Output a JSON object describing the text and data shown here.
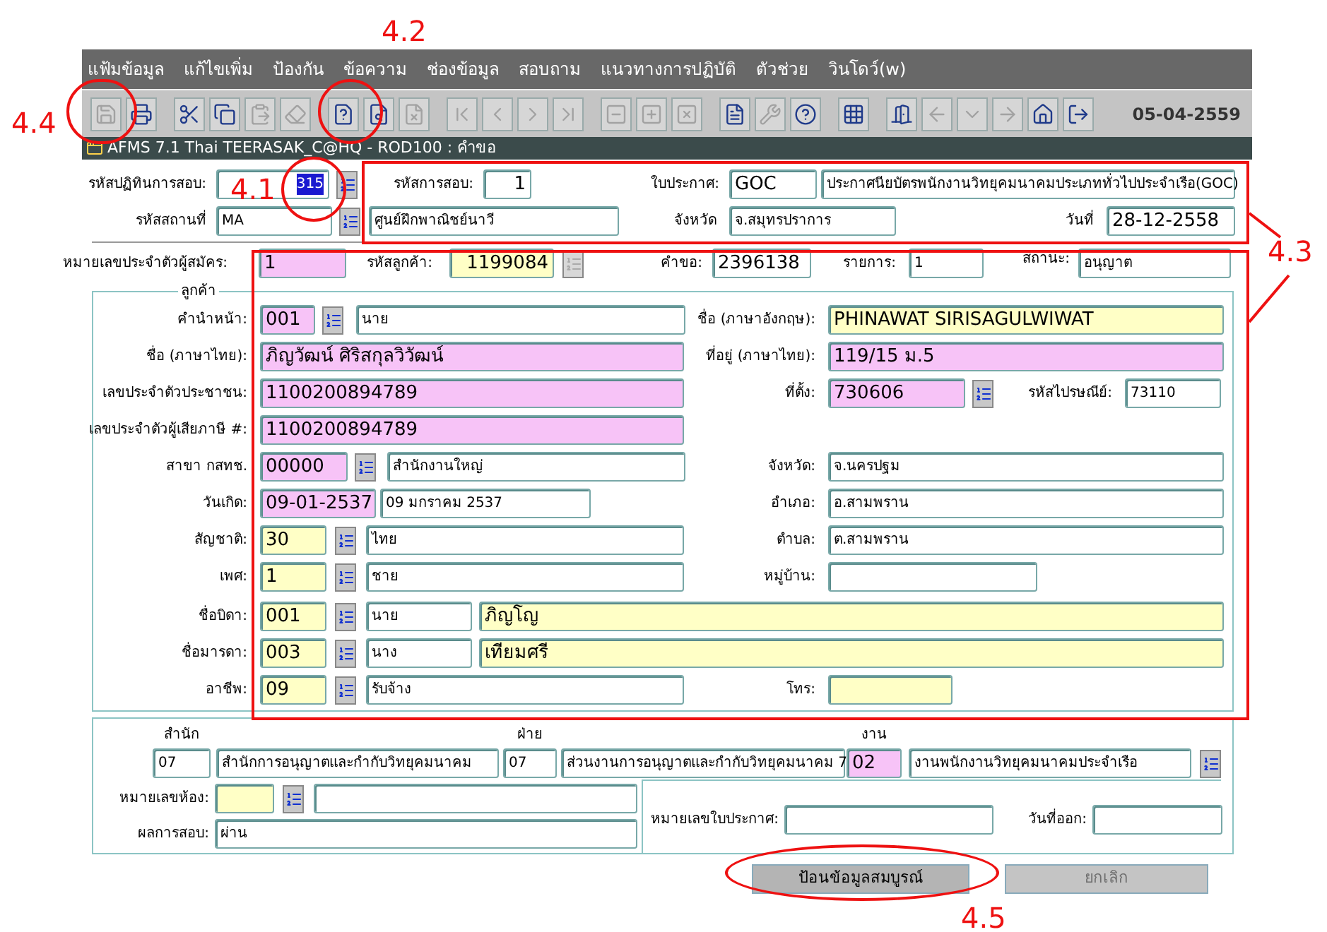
{
  "menu": [
    "แฟ้มข้อมูล",
    "แก้ไขเพิ่ม",
    "ป้องกัน",
    "ข้อความ",
    "ช่องข้อมูล",
    "สอบถาม",
    "แนวทางการปฏิบัติ",
    "ตัวช่วย",
    "วินโดว์(w)"
  ],
  "toolbar": [
    {
      "buttons": [
        {
          "kind": "save",
          "disabled": true
        },
        {
          "kind": "print",
          "disabled": false
        }
      ]
    },
    {
      "buttons": [
        {
          "kind": "cut",
          "disabled": false
        },
        {
          "kind": "copy",
          "disabled": false
        },
        {
          "kind": "paste",
          "disabled": true
        },
        {
          "kind": "clear",
          "disabled": true
        }
      ]
    },
    {
      "buttons": [
        {
          "kind": "enter_query",
          "disabled": false
        },
        {
          "kind": "execute_query",
          "disabled": false
        },
        {
          "kind": "cancel_query",
          "disabled": true
        }
      ]
    },
    {
      "buttons": [
        {
          "kind": "first",
          "disabled": true
        },
        {
          "kind": "prev",
          "disabled": true
        },
        {
          "kind": "next",
          "disabled": true
        },
        {
          "kind": "last",
          "disabled": true
        }
      ]
    },
    {
      "buttons": [
        {
          "kind": "delete_record",
          "disabled": true
        },
        {
          "kind": "insert_record",
          "disabled": true
        },
        {
          "kind": "clear_record",
          "disabled": true
        }
      ]
    },
    {
      "buttons": [
        {
          "kind": "report",
          "disabled": false
        },
        {
          "kind": "tool",
          "disabled": true
        },
        {
          "kind": "help",
          "disabled": false
        }
      ]
    },
    {
      "buttons": [
        {
          "kind": "calendar",
          "disabled": false
        }
      ]
    },
    {
      "buttons": [
        {
          "kind": "door",
          "disabled": false
        },
        {
          "kind": "back",
          "disabled": true
        },
        {
          "kind": "dropdown",
          "disabled": true
        },
        {
          "kind": "forward",
          "disabled": true
        },
        {
          "kind": "home",
          "disabled": false
        },
        {
          "kind": "exit",
          "disabled": false
        }
      ]
    }
  ],
  "toolbar_date": "05-04-2559",
  "window": {
    "title": "AFMS 7.1 Thai TEERASAK_C@HQ - ROD100 : คำขอ"
  },
  "header": {
    "exam_calendar": {
      "label": "รหัสปฏิทินการสอบ:",
      "value": "315",
      "kind": "plain",
      "text_selected": true,
      "lookup": {
        "disabled": false
      }
    },
    "exam_code": {
      "label": "รหัสการสอบ:",
      "value": "1",
      "kind": "plain"
    },
    "certificate": {
      "label": "ใบประกาศ:",
      "value": "GOC",
      "kind": "plain"
    },
    "certificate_name": {
      "value": "ประกาศนียบัตรพนักงานวิทยุคมนาคมประเภททั่วไปประจำเรือ(GOC)",
      "kind": "plain"
    },
    "venue": {
      "label": "รหัสสถานที่",
      "value": "MA",
      "kind": "plain",
      "lookup": {
        "disabled": false
      }
    },
    "venue_name": {
      "value": "ศูนย์ฝึกพาณิชย์นาวี",
      "kind": "plain"
    },
    "province": {
      "label": "จังหวัด",
      "value": "จ.สมุทรปราการ",
      "kind": "plain"
    },
    "date": {
      "label": "วันที่",
      "value": "28-12-2558",
      "kind": "plain"
    }
  },
  "application": {
    "applicant_no": {
      "label": "หมายเลขประจำตัวผู้สมัคร:",
      "value": "1",
      "kind": "required"
    },
    "customer_code": {
      "label": "รหัสลูกค้า:",
      "value": "1199084",
      "kind": "editable",
      "lookup": {
        "disabled": true
      }
    },
    "request": {
      "label": "คำขอ:",
      "value": "2396138",
      "kind": "plain"
    },
    "item": {
      "label": "รายการ:",
      "value": "1",
      "kind": "plain"
    },
    "status": {
      "label": "สถานะ:",
      "value": "อนุญาต",
      "kind": "plain"
    }
  },
  "customer": {
    "title": "ลูกค้า",
    "prefix": {
      "label": "คำนำหน้า:",
      "value": "001",
      "kind": "required",
      "lookup": {
        "disabled": false
      }
    },
    "prefix_name": {
      "value": "นาย",
      "kind": "plain"
    },
    "name_en": {
      "label": "ชื่อ (ภาษาอังกฤษ):",
      "value": "PHINAWAT SIRISAGULWIWAT",
      "kind": "editable"
    },
    "name_th": {
      "label": "ชื่อ (ภาษาไทย):",
      "value": "ภิญวัฒน์ ศิริสกุลวิวัฒน์",
      "kind": "required"
    },
    "address": {
      "label": "ที่อยู่ (ภาษาไทย):",
      "value": "119/15 ม.5",
      "kind": "required"
    },
    "national_id": {
      "label": "เลขประจำตัวประชาชน:",
      "value": "1100200894789",
      "kind": "required"
    },
    "location": {
      "label": "ที่ตั้ง:",
      "value": "730606",
      "kind": "required",
      "lookup": {
        "disabled": false
      }
    },
    "postal_code": {
      "label": "รหัสไปรษณีย์:",
      "value": "73110",
      "kind": "plain"
    },
    "tax_id": {
      "label": "เลขประจำตัวผู้เสียภาษี #:",
      "value": "1100200894789",
      "kind": "required"
    },
    "branch": {
      "label": "สาขา กสทช.",
      "value": "00000",
      "kind": "required",
      "lookup": {
        "disabled": false
      }
    },
    "branch_name": {
      "value": "สำนักงานใหญ่",
      "kind": "plain"
    },
    "province": {
      "label": "จังหวัด:",
      "value": "จ.นครปฐม",
      "kind": "plain"
    },
    "birth_date": {
      "label": "วันเกิด:",
      "value": "09-01-2537",
      "kind": "required"
    },
    "birth_date_text": {
      "value": "09 มกราคม 2537",
      "kind": "plain"
    },
    "district": {
      "label": "อำเภอ:",
      "value": "อ.สามพราน",
      "kind": "plain"
    },
    "nationality": {
      "label": "สัญชาติ:",
      "value": "30",
      "kind": "editable",
      "lookup": {
        "disabled": false
      }
    },
    "nationality_name": {
      "value": "ไทย",
      "kind": "plain"
    },
    "subdistrict": {
      "label": "ตำบล:",
      "value": "ต.สามพราน",
      "kind": "plain"
    },
    "gender": {
      "label": "เพศ:",
      "value": "1",
      "kind": "editable",
      "lookup": {
        "disabled": false
      }
    },
    "gender_name": {
      "value": "ชาย",
      "kind": "plain"
    },
    "village": {
      "label": "หมู่บ้าน:",
      "kind": "plain"
    },
    "father": {
      "label": "ชื่อบิดา:",
      "value": "001",
      "kind": "editable",
      "lookup": {
        "disabled": false
      }
    },
    "father_prefix": {
      "value": "นาย",
      "kind": "plain"
    },
    "father_name": {
      "value": "ภิญโญ",
      "kind": "editable"
    },
    "mother": {
      "label": "ชื่อมารดา:",
      "value": "003",
      "kind": "editable",
      "lookup": {
        "disabled": false
      }
    },
    "mother_prefix": {
      "value": "นาง",
      "kind": "plain"
    },
    "mother_name": {
      "value": "เทียมศรี",
      "kind": "editable"
    },
    "occupation": {
      "label": "อาชีพ:",
      "value": "09",
      "kind": "editable",
      "lookup": {
        "disabled": false
      }
    },
    "occupation_name": {
      "value": "รับจ้าง",
      "kind": "plain"
    },
    "phone": {
      "label": "โทร:",
      "kind": "editable"
    }
  },
  "office": {
    "bureau": {
      "label": "สำนัก",
      "value": "07",
      "kind": "plain"
    },
    "bureau_name": {
      "value": "สำนักการอนุญาตและกำกับวิทยุคมนาคม",
      "kind": "plain"
    },
    "division": {
      "label": "ฝ่าย",
      "value": "07",
      "kind": "plain"
    },
    "division_name": {
      "value": "ส่วนงานการอนุญาตและกำกับวิทยุคมนาคม 7",
      "kind": "plain"
    },
    "section": {
      "label": "งาน",
      "value": "02",
      "kind": "required"
    },
    "section_name": {
      "value": "งานพนักงานวิทยุคมนาคมประจำเรือ",
      "kind": "plain",
      "lookup": {
        "disabled": false
      }
    },
    "room": {
      "label": "หมายเลขห้อง:",
      "kind": "editable",
      "lookup": {
        "disabled": false
      }
    },
    "room_name": {
      "kind": "plain"
    },
    "result": {
      "label": "ผลการสอบ:",
      "value": "ผ่าน",
      "kind": "plain"
    },
    "certificate_no": {
      "label": "หมายเลขใบประกาศ:",
      "kind": "plain"
    },
    "issue_date": {
      "label": "วันที่ออก:",
      "kind": "plain"
    }
  },
  "buttons": [
    {
      "label": "ป้อนข้อมูลสมบูรณ์",
      "disabled": false
    },
    {
      "label": "ยกเลิก",
      "disabled": true
    }
  ],
  "annotations": [
    {
      "label": "4.1",
      "kind": "circle"
    },
    {
      "label": "4.2",
      "kind": "circle"
    },
    {
      "label": "4.3",
      "kind": "frames"
    },
    {
      "label": "4.4",
      "kind": "circle"
    },
    {
      "label": "4.5",
      "kind": "ellipse"
    }
  ]
}
